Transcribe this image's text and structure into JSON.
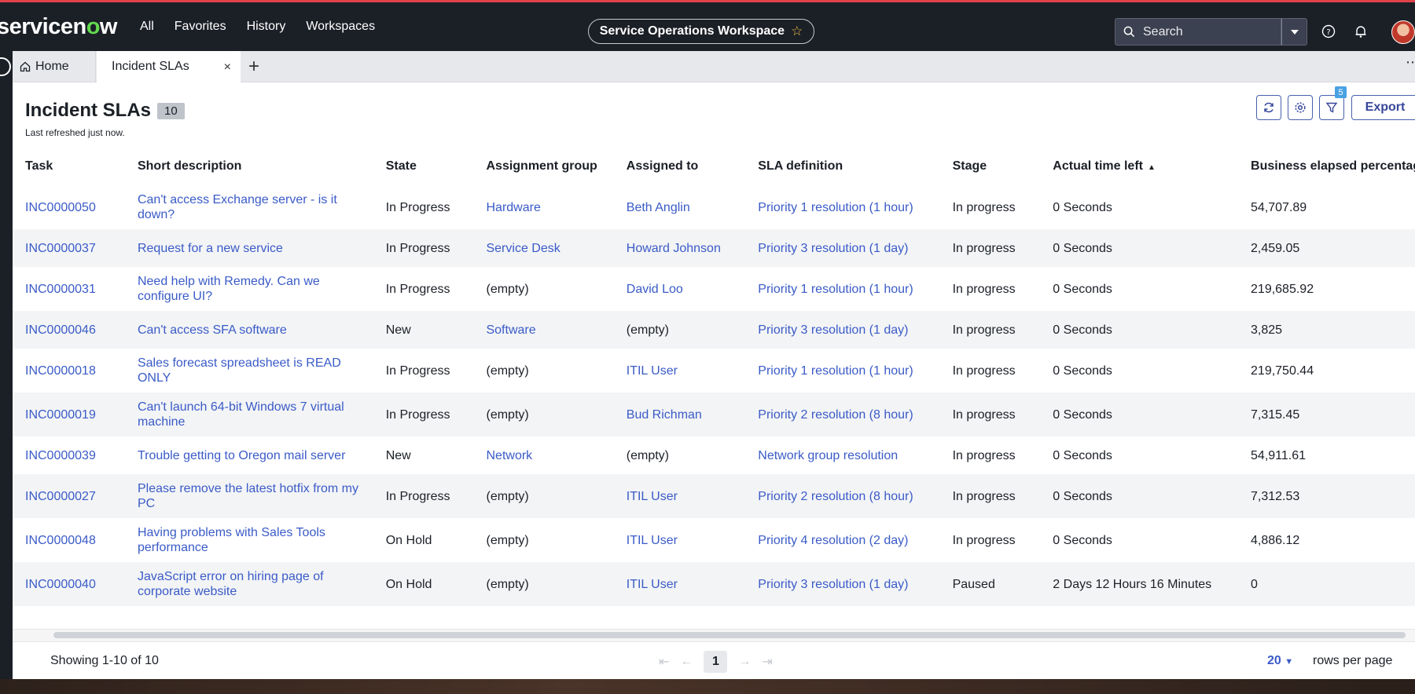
{
  "topbar": {
    "logo_prefix": "servicen",
    "logo_o": "o",
    "logo_suffix": "w",
    "nav": [
      "All",
      "Favorites",
      "History",
      "Workspaces"
    ],
    "workspace": "Service Operations Workspace",
    "search_placeholder": "Search"
  },
  "tabs": {
    "home": "Home",
    "active": "Incident SLAs"
  },
  "header": {
    "title": "Incident SLAs",
    "count": "10",
    "refreshed": "Last refreshed just now.",
    "filter_count": "5",
    "export_label": "Export"
  },
  "table": {
    "columns": [
      "Task",
      "Short description",
      "State",
      "Assignment group",
      "Assigned to",
      "SLA definition",
      "Stage",
      "Actual time left",
      "Business elapsed percentage"
    ],
    "rows": [
      {
        "task": "INC0000050",
        "desc": "Can't access Exchange server - is it down?",
        "state": "In Progress",
        "group": "Hardware",
        "assigned": "Beth Anglin",
        "sla": "Priority 1 resolution (1 hour)",
        "stage": "In progress",
        "time_left": "0 Seconds",
        "elapsed": "54,707.89"
      },
      {
        "task": "INC0000037",
        "desc": "Request for a new service",
        "state": "In Progress",
        "group": "Service Desk",
        "assigned": "Howard Johnson",
        "sla": "Priority 3 resolution (1 day)",
        "stage": "In progress",
        "time_left": "0 Seconds",
        "elapsed": "2,459.05"
      },
      {
        "task": "INC0000031",
        "desc": "Need help with Remedy. Can we configure UI?",
        "state": "In Progress",
        "group": "(empty)",
        "assigned": "David Loo",
        "sla": "Priority 1 resolution (1 hour)",
        "stage": "In progress",
        "time_left": "0 Seconds",
        "elapsed": "219,685.92"
      },
      {
        "task": "INC0000046",
        "desc": "Can't access SFA software",
        "state": "New",
        "group": "Software",
        "assigned": "(empty)",
        "sla": "Priority 3 resolution (1 day)",
        "stage": "In progress",
        "time_left": "0 Seconds",
        "elapsed": "3,825"
      },
      {
        "task": "INC0000018",
        "desc": "Sales forecast spreadsheet is READ ONLY",
        "state": "In Progress",
        "group": "(empty)",
        "assigned": "ITIL User",
        "sla": "Priority 1 resolution (1 hour)",
        "stage": "In progress",
        "time_left": "0 Seconds",
        "elapsed": "219,750.44"
      },
      {
        "task": "INC0000019",
        "desc": "Can't launch 64-bit Windows 7 virtual machine",
        "state": "In Progress",
        "group": "(empty)",
        "assigned": "Bud Richman",
        "sla": "Priority 2 resolution (8 hour)",
        "stage": "In progress",
        "time_left": "0 Seconds",
        "elapsed": "7,315.45"
      },
      {
        "task": "INC0000039",
        "desc": "Trouble getting to Oregon mail server",
        "state": "New",
        "group": "Network",
        "assigned": "(empty)",
        "sla": "Network group resolution",
        "stage": "In progress",
        "time_left": "0 Seconds",
        "elapsed": "54,911.61"
      },
      {
        "task": "INC0000027",
        "desc": "Please remove the latest hotfix from my PC",
        "state": "In Progress",
        "group": "(empty)",
        "assigned": "ITIL User",
        "sla": "Priority 2 resolution (8 hour)",
        "stage": "In progress",
        "time_left": "0 Seconds",
        "elapsed": "7,312.53"
      },
      {
        "task": "INC0000048",
        "desc": "Having problems with Sales Tools performance",
        "state": "On Hold",
        "group": "(empty)",
        "assigned": "ITIL User",
        "sla": "Priority 4 resolution (2 day)",
        "stage": "In progress",
        "time_left": "0 Seconds",
        "elapsed": "4,886.12"
      },
      {
        "task": "INC0000040",
        "desc": "JavaScript error on hiring page of corporate website",
        "state": "On Hold",
        "group": "(empty)",
        "assigned": "ITIL User",
        "sla": "Priority 3 resolution (1 day)",
        "stage": "Paused",
        "time_left": "2 Days 12 Hours 16 Minutes",
        "elapsed": "0"
      }
    ]
  },
  "footer": {
    "showing": "Showing 1-10 of 10",
    "page": "1",
    "rows_per_page": "20",
    "rows_per_page_label": "rows per page"
  },
  "colors": {
    "accent": "#3a5bc7",
    "topbar": "#1b1f26",
    "brand_green": "#62d84e"
  }
}
